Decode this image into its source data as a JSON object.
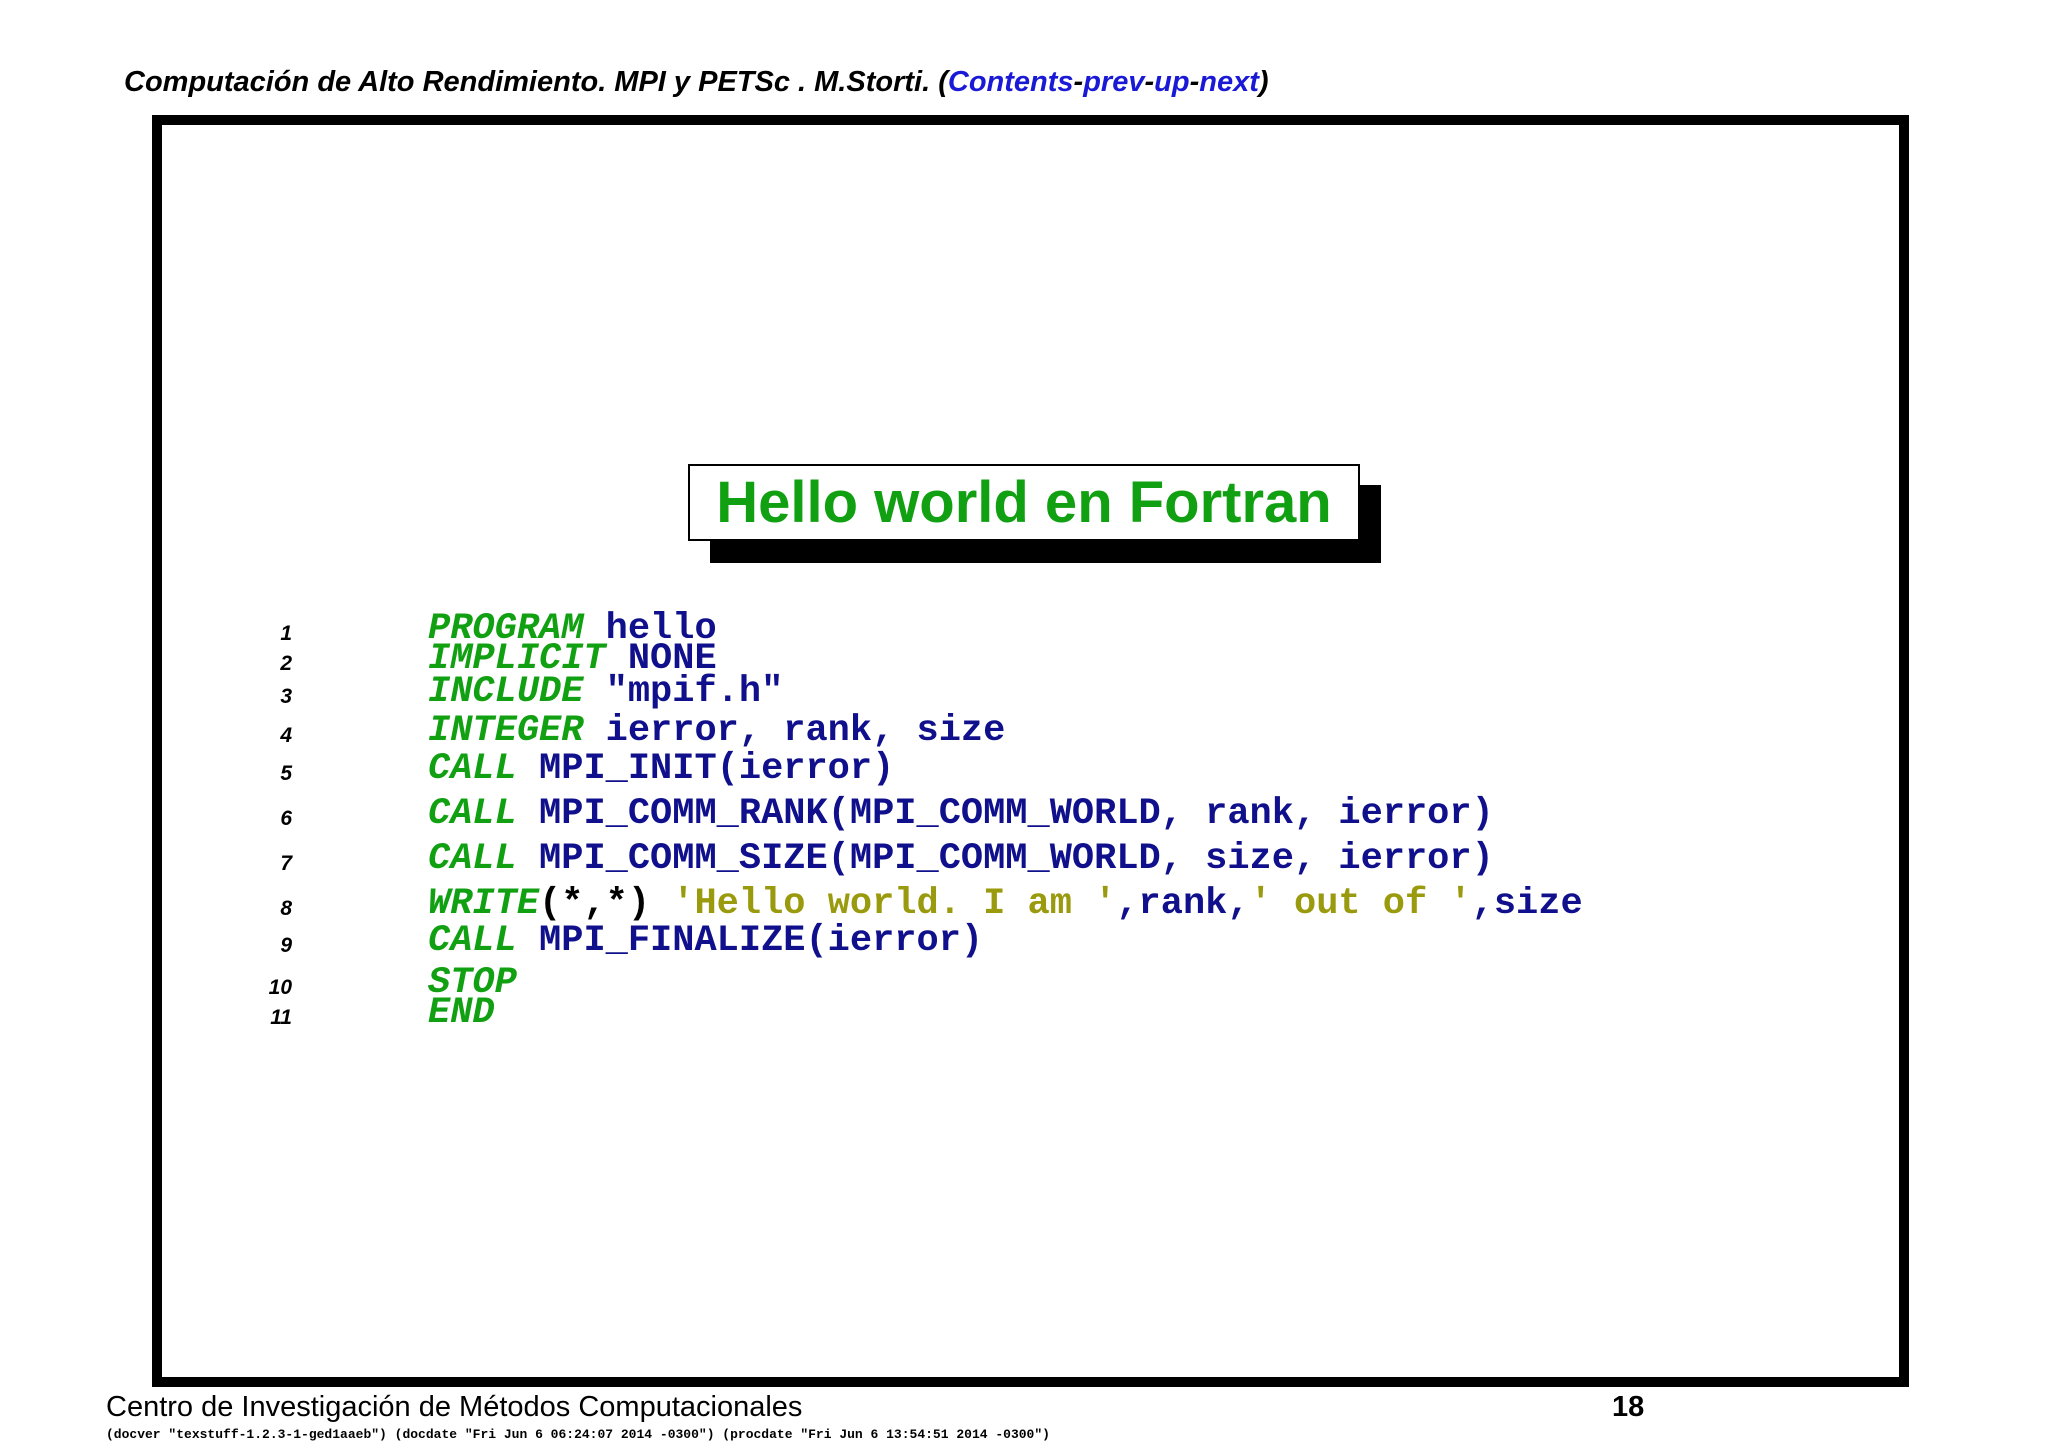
{
  "header": {
    "title": "Computación de Alto Rendimiento. MPI y PETSc . M.Storti.",
    "open_paren": "(",
    "nav": [
      {
        "label": "Contents"
      },
      {
        "label": "prev"
      },
      {
        "label": "up"
      },
      {
        "label": "next"
      }
    ],
    "close_paren": ")"
  },
  "slide": {
    "title": "Hello world en Fortran"
  },
  "code": {
    "lines": [
      {
        "num": "1",
        "t0": "PROGRAM",
        "t1": " hello"
      },
      {
        "num": "2",
        "t0": "IMPLICIT",
        "t1": " NONE"
      },
      {
        "num": "3",
        "t0": "INCLUDE",
        "t1": " \"mpif.h\""
      },
      {
        "num": "4",
        "t0": "INTEGER",
        "t1": " ierror, rank, size"
      },
      {
        "num": "5",
        "t0": "CALL",
        "t1": " MPI_INIT(ierror)"
      },
      {
        "num": "6",
        "t0": "CALL",
        "t1": " MPI_COMM_RANK(MPI_COMM_WORLD, rank, ierror)"
      },
      {
        "num": "7",
        "t0": "CALL",
        "t1": " MPI_COMM_SIZE(MPI_COMM_WORLD, size, ierror)"
      },
      {
        "num": "8",
        "t0": "WRITE",
        "t1": "(*,*) ",
        "t2": "'Hello world. I am '",
        "t3": ",rank,",
        "t4": "' out of '",
        "t5": ",size"
      },
      {
        "num": "9",
        "t0": "CALL",
        "t1": " MPI_FINALIZE(ierror)"
      },
      {
        "num": "10",
        "t0": "STOP"
      },
      {
        "num": "11",
        "t0": "END"
      }
    ]
  },
  "footer": {
    "institution": "Centro de Investigación de Métodos Computacionales",
    "page": "18",
    "meta": "(docver \"texstuff-1.2.3-1-ged1aaeb\") (docdate \"Fri Jun 6 06:24:07 2014 -0300\") (procdate \"Fri Jun 6 13:54:51 2014 -0300\")"
  },
  "colors": {
    "keyword": "#11a011",
    "identifier": "#10108c",
    "string": "#9a9a0e",
    "link": "#1a1ad6"
  }
}
